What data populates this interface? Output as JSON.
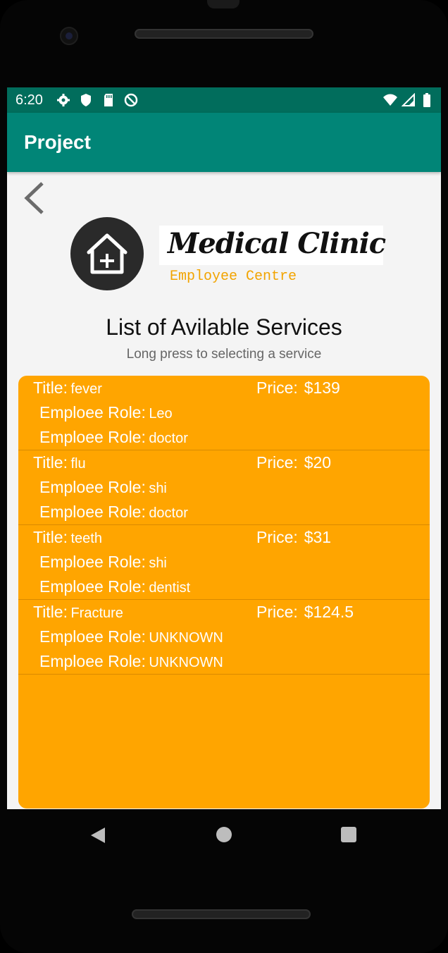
{
  "status": {
    "time": "6:20",
    "left_icons": [
      "gear-icon",
      "shield-icon",
      "sd-card-icon",
      "do-not-disturb-icon"
    ],
    "right_icons": [
      "wifi-icon",
      "signal-icon",
      "battery-icon"
    ]
  },
  "appbar": {
    "title": "Project"
  },
  "header": {
    "brand": "Medical Clinic",
    "brand_sub": "Employee Centre",
    "list_title": "List of Avilable Services",
    "list_subtitle": "Long press to selecting a service"
  },
  "labels": {
    "title": "Title:",
    "price": "Price:",
    "role": "Emploee Role:"
  },
  "services": [
    {
      "title": "fever",
      "price": "$139",
      "employee": "Leo",
      "role": "doctor"
    },
    {
      "title": "flu",
      "price": "$20",
      "employee": "shi",
      "role": "doctor"
    },
    {
      "title": "teeth",
      "price": "$31",
      "employee": "shi",
      "role": "dentist"
    },
    {
      "title": "Fracture",
      "price": "$124.5",
      "employee": "UNKNOWN",
      "role": "UNKNOWN"
    }
  ],
  "colors": {
    "statusbar": "#016d5c",
    "appbar": "#018577",
    "list_bg": "#ffa500",
    "brand_sub": "#f2a400"
  }
}
